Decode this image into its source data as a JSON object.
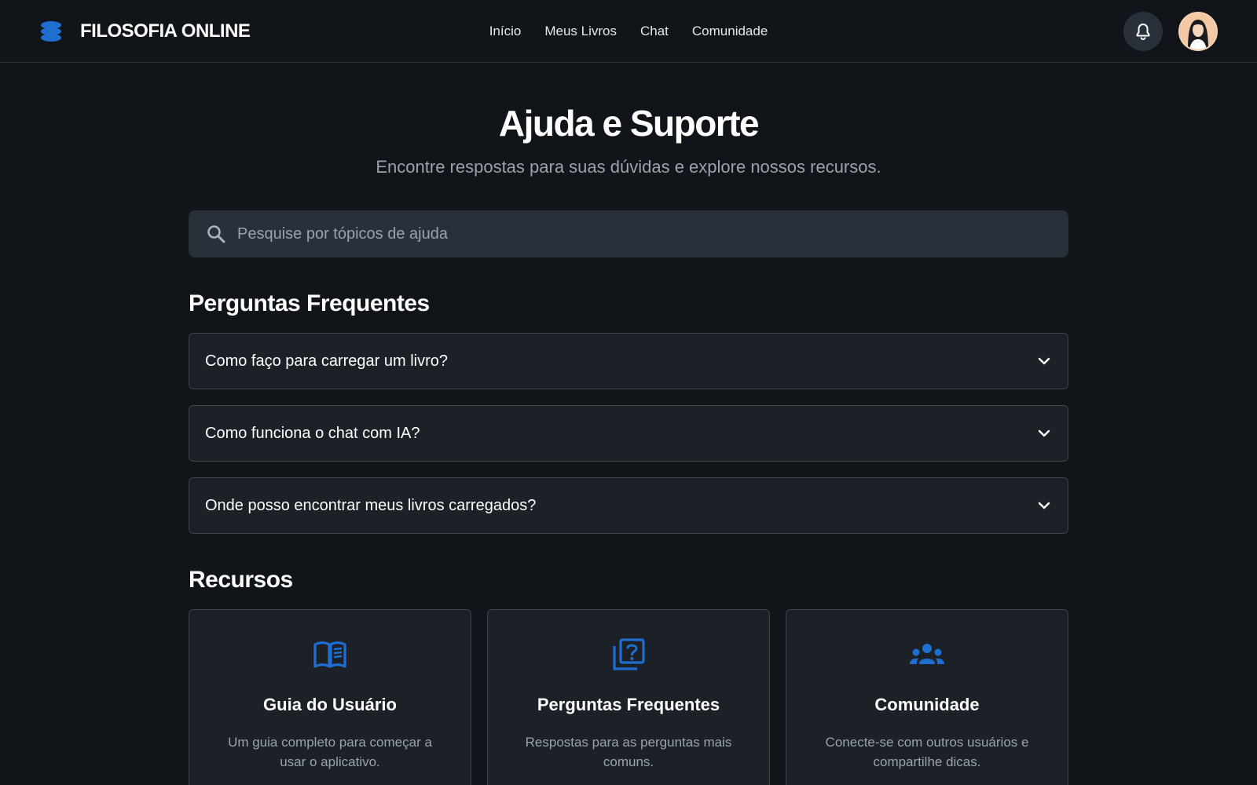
{
  "header": {
    "brand": "FILOSOFIA ONLINE",
    "nav": [
      "Início",
      "Meus Livros",
      "Chat",
      "Comunidade"
    ]
  },
  "main": {
    "title": "Ajuda e Suporte",
    "subtitle": "Encontre respostas para suas dúvidas e explore nossos recursos.",
    "search": {
      "placeholder": "Pesquise por tópicos de ajuda",
      "value": ""
    },
    "faq": {
      "title": "Perguntas Frequentes",
      "items": [
        "Como faço para carregar um livro?",
        "Como funciona o chat com IA?",
        "Onde posso encontrar meus livros carregados?"
      ]
    },
    "resources": {
      "title": "Recursos",
      "cards": [
        {
          "icon": "book-icon",
          "title": "Guia do Usuário",
          "desc": "Um guia completo para começar a usar o aplicativo."
        },
        {
          "icon": "question-library-icon",
          "title": "Perguntas Frequentes",
          "desc": "Respostas para as perguntas mais comuns."
        },
        {
          "icon": "groups-icon",
          "title": "Comunidade",
          "desc": "Conecte-se com outros usuários e compartilhe dicas."
        }
      ]
    }
  },
  "colors": {
    "background": "#111418",
    "surface": "#1c2027",
    "input": "#283039",
    "accent": "#1f6fd1",
    "muted_text": "#9aa3ad"
  }
}
